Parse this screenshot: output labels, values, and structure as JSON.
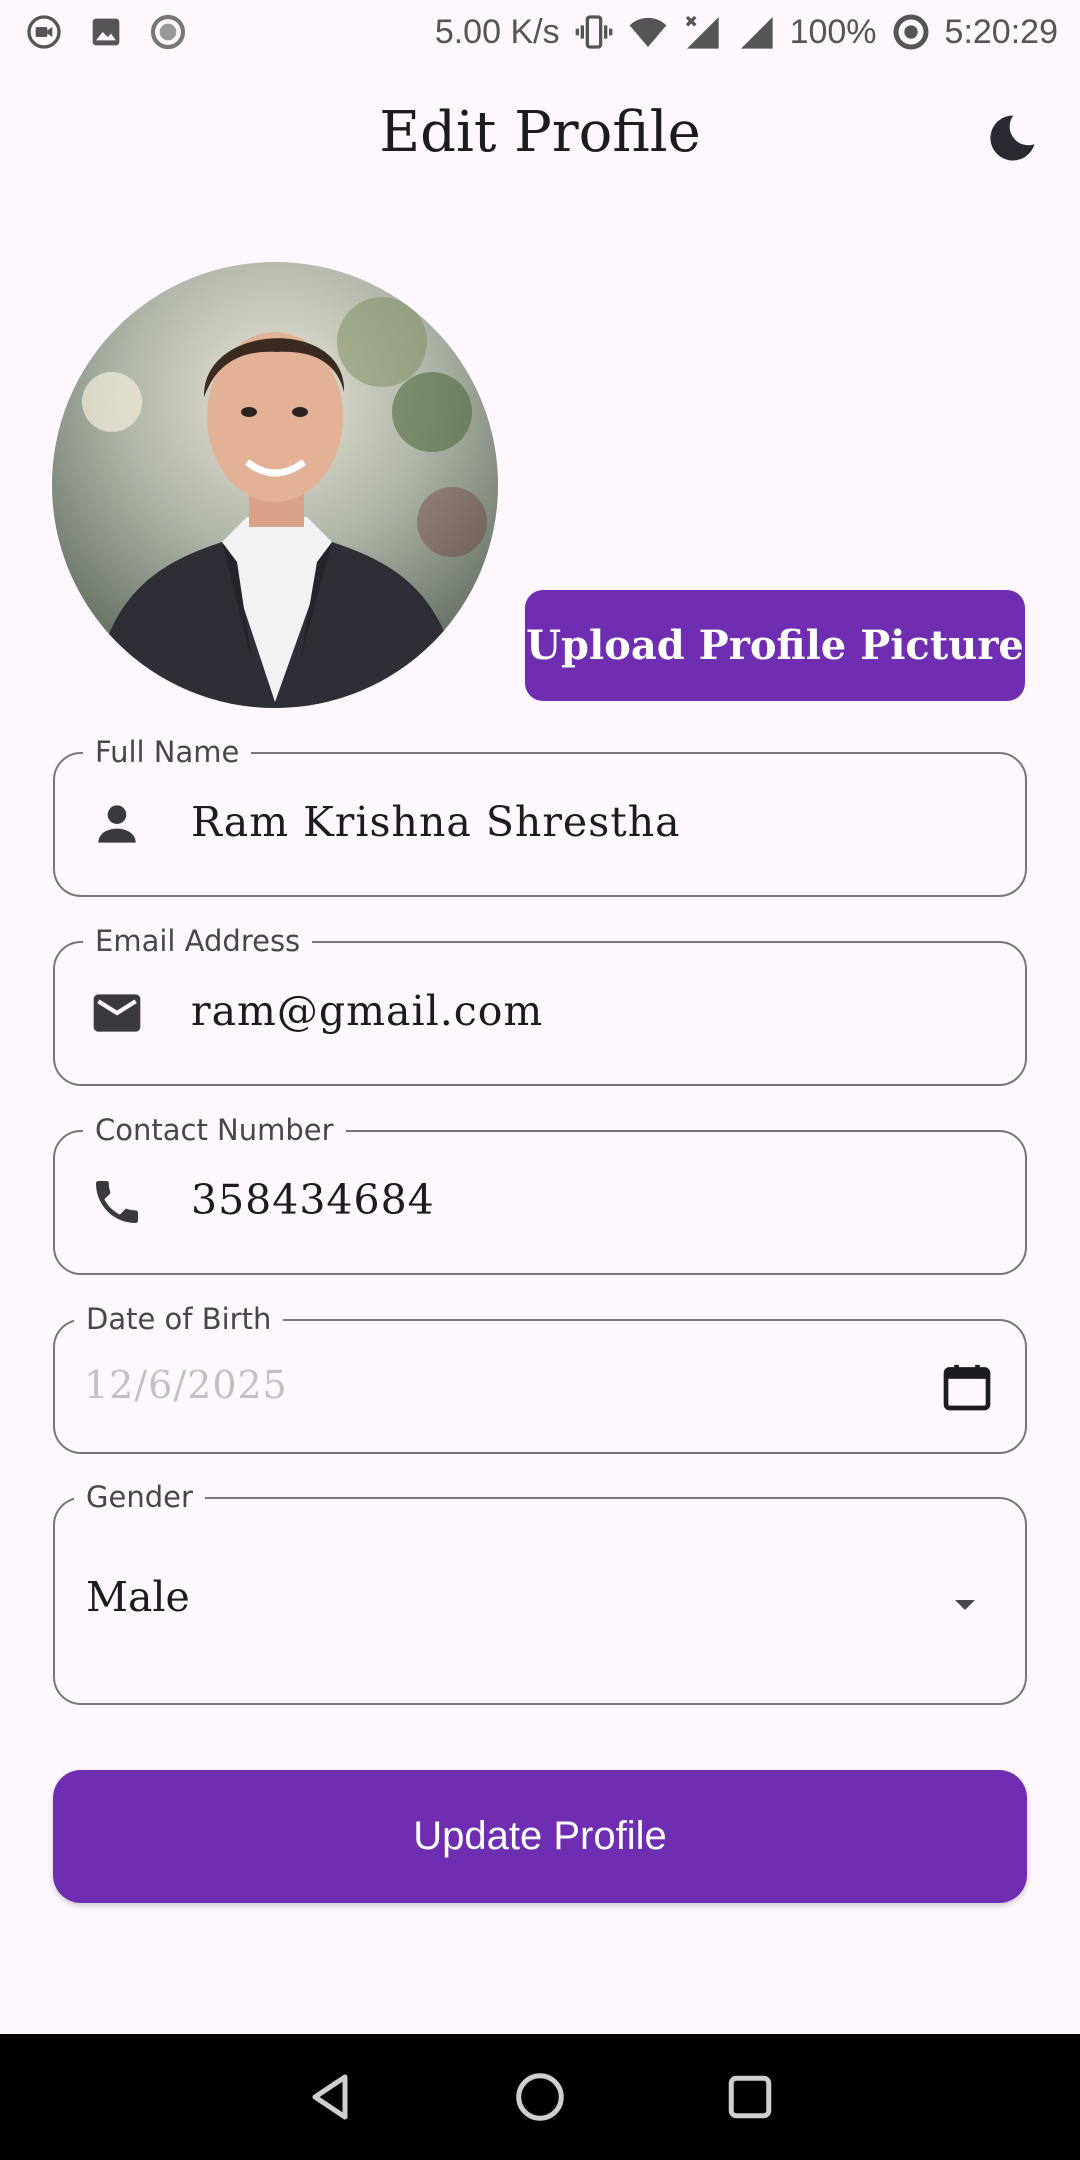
{
  "status_bar": {
    "network_speed": "5.00 K/s",
    "battery": "100%",
    "time": "5:20:29",
    "icons": [
      "video-camera-icon",
      "gallery-icon",
      "record-icon",
      "vibrate-icon",
      "wifi-icon",
      "signal-off-icon",
      "signal-icon",
      "battery-saver-icon"
    ]
  },
  "app_bar": {
    "title": "Edit Profile",
    "theme_toggle_icon": "moon-icon"
  },
  "profile": {
    "avatar_icon": "profile-photo",
    "upload_label": "Upload Profile Picture"
  },
  "form": {
    "full_name": {
      "label": "Full Name",
      "value": "Ram Krishna Shrestha",
      "icon": "person-icon"
    },
    "email": {
      "label": "Email Address",
      "value": "ram@gmail.com",
      "icon": "mail-icon"
    },
    "contact": {
      "label": "Contact Number",
      "value": "358434684",
      "icon": "phone-icon"
    },
    "dob": {
      "label": "Date of Birth",
      "placeholder": "12/6/2025",
      "icon": "calendar-icon"
    },
    "gender": {
      "label": "Gender",
      "value": "Male",
      "icon": "dropdown-arrow-icon"
    }
  },
  "actions": {
    "update_label": "Update Profile"
  },
  "colors": {
    "background": "#fef7fe",
    "primary": "#6f2db2",
    "outline": "#79747e",
    "text": "#1d1b20"
  }
}
